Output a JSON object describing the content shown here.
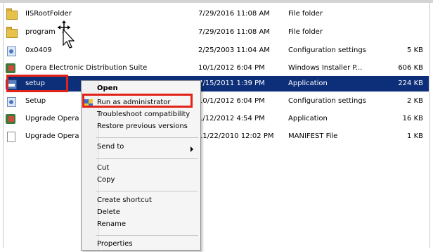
{
  "files": [
    {
      "name": "IISRootFolder",
      "date": "7/29/2016 11:08 AM",
      "type": "File folder",
      "size": "",
      "icon": "folder-icon"
    },
    {
      "name": "program",
      "date": "7/29/2016 11:08 AM",
      "type": "File folder",
      "size": "",
      "icon": "folder-icon"
    },
    {
      "name": "0x0409",
      "date": "2/25/2003 11:04 AM",
      "type": "Configuration settings",
      "size": "5 KB",
      "icon": "config-file-icon"
    },
    {
      "name": "Opera Electronic Distribution Suite",
      "date": "10/1/2012 6:04 PM",
      "type": "Windows Installer P...",
      "size": "606 KB",
      "icon": "installer-icon"
    },
    {
      "name": "setup",
      "date": "7/15/2011 1:39 PM",
      "type": "Application",
      "size": "224 KB",
      "icon": "application-icon"
    },
    {
      "name": "Setup",
      "date": "10/1/2012 6:04 PM",
      "type": "Configuration settings",
      "size": "2 KB",
      "icon": "config-file-icon"
    },
    {
      "name": "Upgrade Opera",
      "date": "1/12/2012 4:54 PM",
      "type": "Application",
      "size": "16 KB",
      "icon": "installer-icon"
    },
    {
      "name": "Upgrade Opera",
      "date": "11/22/2010 12:02 PM",
      "type": "MANIFEST File",
      "size": "1 KB",
      "icon": "file-icon"
    }
  ],
  "context_menu": {
    "open": "Open",
    "run_as_admin": "Run as administrator",
    "troubleshoot": "Troubleshoot compatibility",
    "restore": "Restore previous versions",
    "send_to": "Send to",
    "cut": "Cut",
    "copy": "Copy",
    "create_shortcut": "Create shortcut",
    "delete": "Delete",
    "rename": "Rename",
    "properties": "Properties"
  },
  "colors": {
    "selection": "#0d2f7a",
    "highlight": "#e2231a"
  }
}
